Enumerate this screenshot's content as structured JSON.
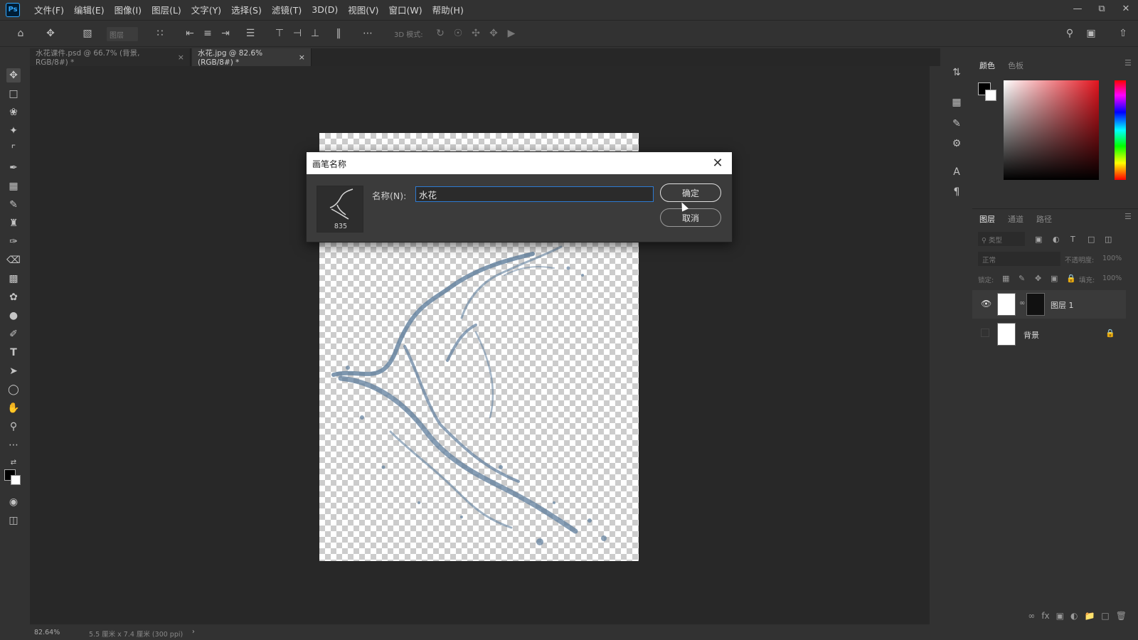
{
  "app": {
    "logo": "Ps"
  },
  "menu": [
    "文件(F)",
    "编辑(E)",
    "图像(I)",
    "图层(L)",
    "文字(Y)",
    "选择(S)",
    "滤镜(T)",
    "3D(D)",
    "视图(V)",
    "窗口(W)",
    "帮助(H)"
  ],
  "options_bar": {
    "layer_select": "图层",
    "mode_3d": "3D 模式:"
  },
  "tabs": [
    {
      "label": "水花课件.psd @ 66.7% (背景, RGB/8#) *",
      "close": "×"
    },
    {
      "label": "水花.jpg @ 82.6%(RGB/8#) *",
      "close": "×"
    }
  ],
  "status": {
    "zoom": "82.64%",
    "doc_size": "5.5 厘米 x 7.4 厘米 (300 ppi)",
    "arrow": "›"
  },
  "color_panel": {
    "tabs": [
      "颜色",
      "色板"
    ]
  },
  "layers_panel": {
    "tabs": [
      "图层",
      "通道",
      "路径"
    ],
    "filter": "类型",
    "blend_mode": "正常",
    "opacity_label": "不透明度:",
    "opacity_value": "100%",
    "lock_label": "锁定:",
    "fill_label": "填充:",
    "fill_value": "100%",
    "layers": [
      {
        "name": "图层 1",
        "visible": true,
        "locked": false
      },
      {
        "name": "背景",
        "visible": false,
        "locked": true
      }
    ]
  },
  "dialog": {
    "title": "画笔名称",
    "brush_size": "835",
    "name_label": "名称(N):",
    "name_value": "水花",
    "ok_label": "确定",
    "cancel_label": "取消"
  },
  "colors": {
    "accent": "#31a8ff",
    "focus": "#2d7ad2"
  }
}
